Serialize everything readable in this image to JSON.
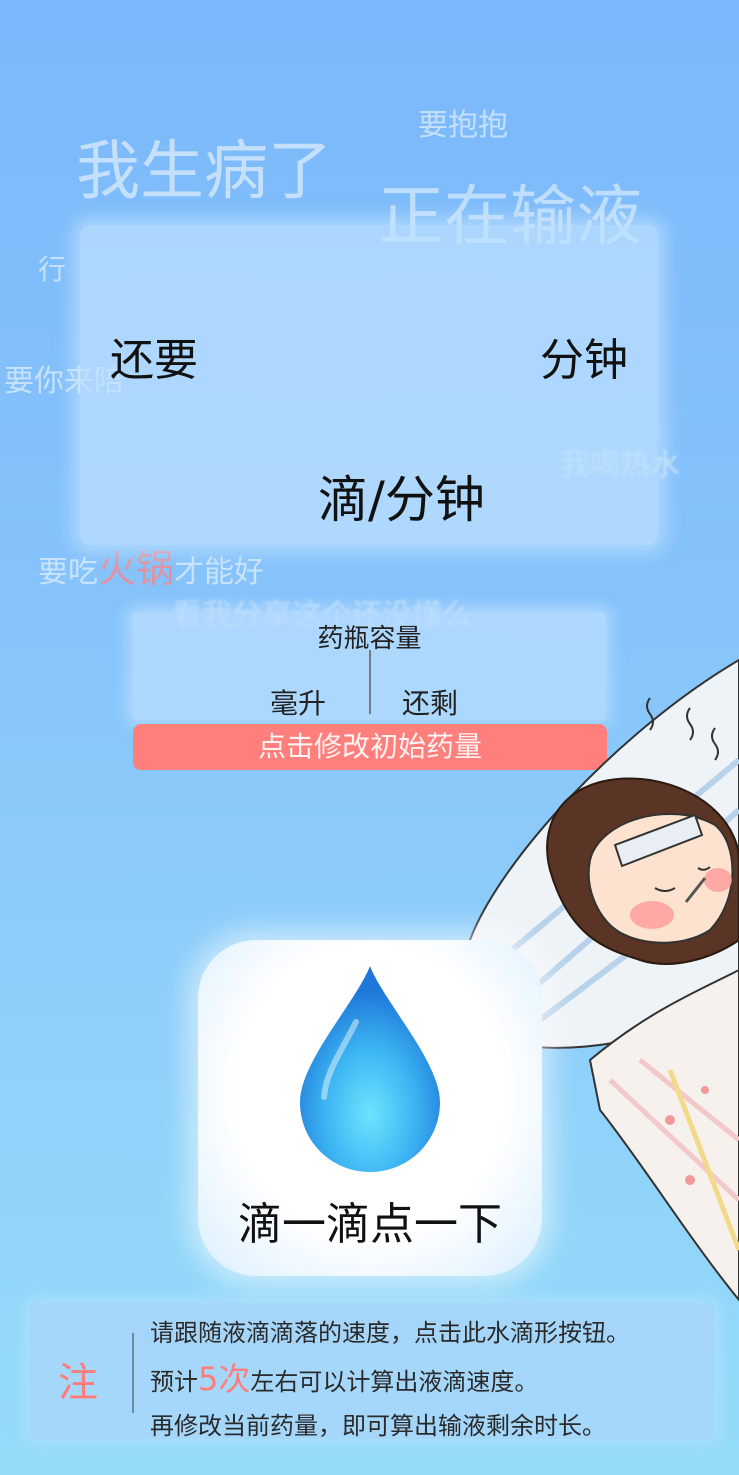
{
  "background_words": {
    "sick": "我生病了",
    "infusion": "正在输液",
    "hug": "要抱抱",
    "ok": "行",
    "come": "要你来陪",
    "hot_water": "我喝热水",
    "hotpot_pre": "要吃",
    "hotpot_hl": "火锅",
    "hotpot_post": "才能好",
    "share": "看我分享这个还没懂么"
  },
  "panel": {
    "remaining_prefix": "还要",
    "remaining_unit": "分钟",
    "rate_unit": "滴/分钟"
  },
  "volume": {
    "title": "药瓶容量",
    "unit": "毫升",
    "remaining": "还剩"
  },
  "edit_button": "点击修改初始药量",
  "drop_button": "滴一滴点一下",
  "note": {
    "mark": "注",
    "line1": "请跟随液滴滴落的速度，点击此水滴形按钮。",
    "line2_pre": "预计",
    "line2_hl": "5次",
    "line2_post": "左右可以计算出液滴速度。",
    "line3": "再修改当前药量，即可算出输液剩余时长。"
  },
  "colors": {
    "accent_red": "#ff7f7c",
    "panel": "#bee0ff",
    "drop_blue": "#3aa6f0"
  }
}
